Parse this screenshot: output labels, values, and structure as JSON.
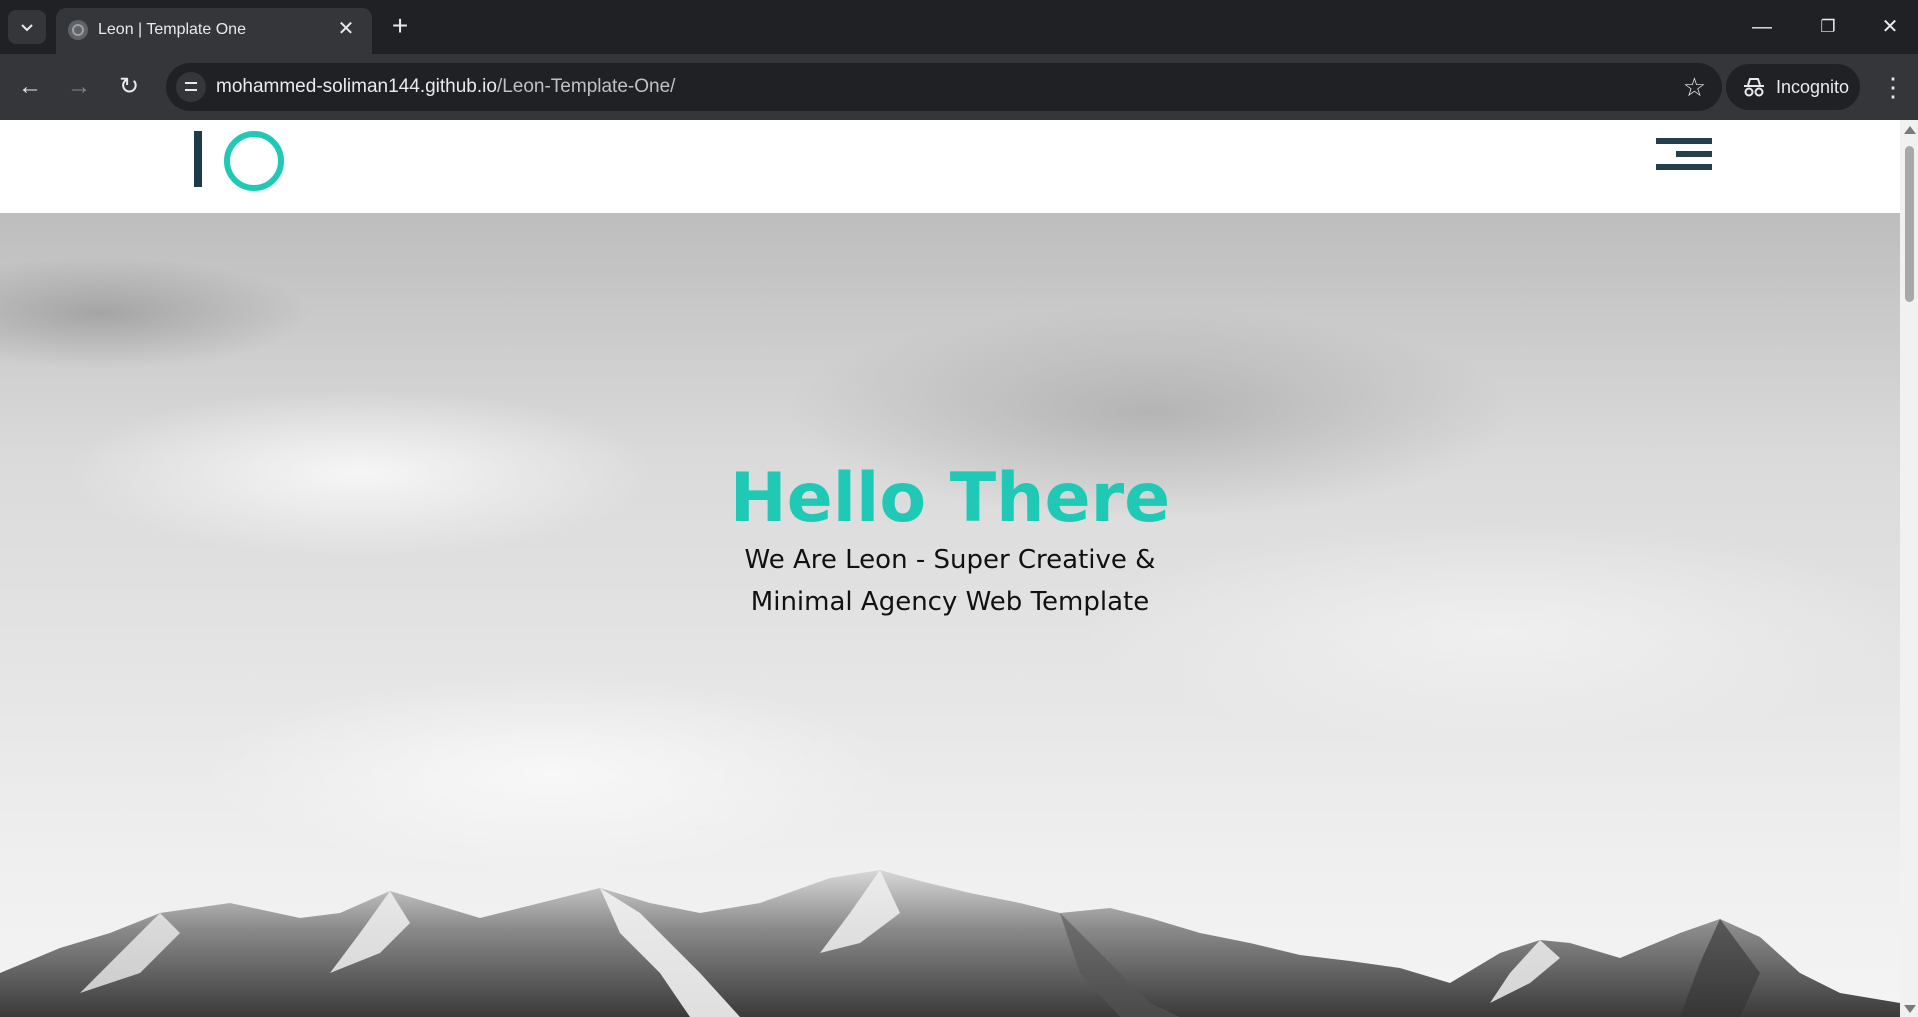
{
  "browser": {
    "tab": {
      "title": "Leon | Template One",
      "favicon": "globe-icon"
    },
    "url": {
      "host": "mohammed-soliman144.github.io",
      "path": "/Leon-Template-One/"
    },
    "profile_label": "Incognito"
  },
  "site": {
    "logo": {
      "text": "IO",
      "colors": {
        "bar": "#1f3a4a",
        "ring": "#1fc9b5"
      }
    },
    "nav": {
      "icon": "hamburger-menu-icon",
      "color": "#24404f"
    },
    "hero": {
      "title": "Hello There",
      "subtitle_line1": "We Are Leon - Super Creative &",
      "subtitle_line2": "Minimal Agency Web Template",
      "accent_color": "#1fc9b5",
      "background": "grayscale mountain and cloudy sky photo"
    }
  }
}
